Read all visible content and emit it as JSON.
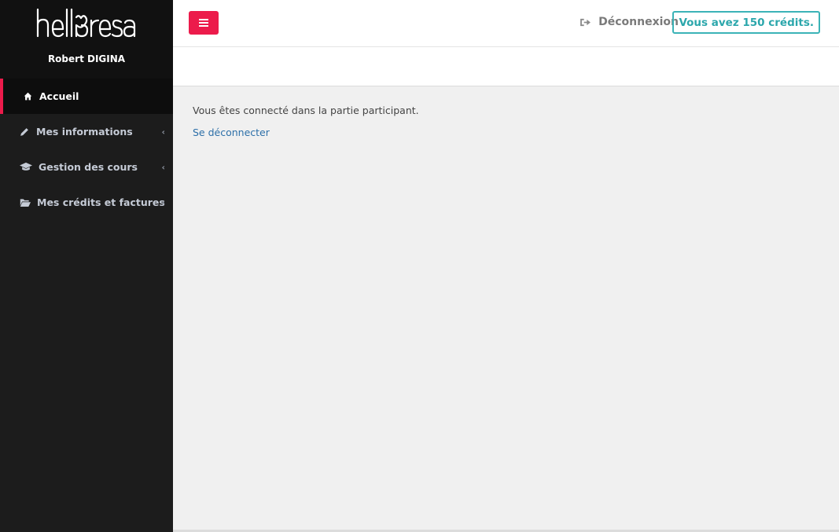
{
  "brand": {
    "logo_text": "hellbresa",
    "user_name": "Robert DIGINA",
    "accent_color": "#ec1b4b",
    "teal_color": "#3bb3b7"
  },
  "sidebar": {
    "items": [
      {
        "label": "Accueil",
        "icon": "home-icon",
        "active": true,
        "has_submenu": false
      },
      {
        "label": "Mes informations",
        "icon": "pencil-icon",
        "active": false,
        "has_submenu": true
      },
      {
        "label": "Gestion des cours",
        "icon": "graduation-cap-icon",
        "active": false,
        "has_submenu": true
      },
      {
        "label": "Mes crédits et factures",
        "icon": "folder-open-icon",
        "active": false,
        "has_submenu": true
      }
    ]
  },
  "header": {
    "menu_toggle_icon": "hamburger-icon",
    "logout_label": "Déconnexion",
    "logout_icon": "sign-out-icon",
    "credits_label": "Vous avez 150 crédits."
  },
  "main": {
    "message": "Vous êtes connecté dans la partie participant.",
    "logout_link": "Se déconnecter"
  }
}
